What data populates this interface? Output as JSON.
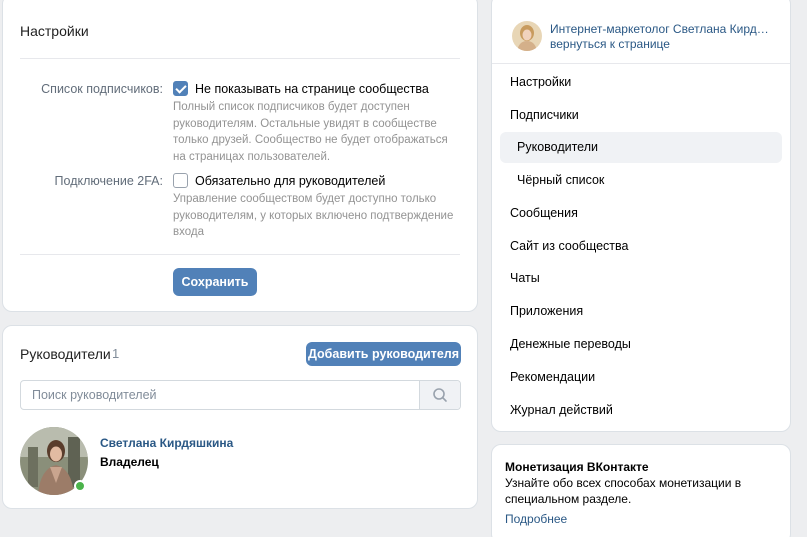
{
  "settings": {
    "title": "Настройки",
    "subscribers_label": "Список подписчиков:",
    "subscribers_option": "Не показывать на странице сообщества",
    "subscribers_checked": true,
    "subscribers_hint": "Полный список подписчиков будет доступен руководителям. Остальные увидят в сообществе только друзей. Сообщество не будет отображаться на страницах пользователей.",
    "twofa_label": "Подключение 2FA:",
    "twofa_option": "Обязательно для руководителей",
    "twofa_checked": false,
    "twofa_hint": "Управление сообществом будет доступно только руководителям, у которых включено подтверждение входа",
    "save_button": "Сохранить"
  },
  "managers": {
    "title": "Руководители",
    "count": "1",
    "add_button": "Добавить руководителя",
    "search_placeholder": "Поиск руководителей",
    "list": [
      {
        "name": "Светлана Кирдяшкина",
        "role": "Владелец",
        "online": true
      }
    ]
  },
  "sidebar": {
    "owner_name": "Интернет-маркетолог Светлана Кирдяшк...",
    "back_link": "вернуться к странице",
    "items": [
      {
        "label": "Настройки",
        "sub": false,
        "active": false
      },
      {
        "label": "Подписчики",
        "sub": false,
        "active": false
      },
      {
        "label": "Руководители",
        "sub": true,
        "active": true
      },
      {
        "label": "Чёрный список",
        "sub": true,
        "active": false
      },
      {
        "label": "Сообщения",
        "sub": false,
        "active": false
      },
      {
        "label": "Сайт из сообщества",
        "sub": false,
        "active": false
      },
      {
        "label": "Чаты",
        "sub": false,
        "active": false
      },
      {
        "label": "Приложения",
        "sub": false,
        "active": false
      },
      {
        "label": "Денежные переводы",
        "sub": false,
        "active": false
      },
      {
        "label": "Рекомендации",
        "sub": false,
        "active": false
      },
      {
        "label": "Журнал действий",
        "sub": false,
        "active": false
      }
    ]
  },
  "monetization": {
    "title": "Монетизация ВКонтакте",
    "text": "Узнайте обо всех способах монетизации в специальном разделе.",
    "link": "Подробнее"
  },
  "colors": {
    "accent": "#5181b8",
    "link": "#2a5885",
    "online": "#4bb34b",
    "background": "#edeef0"
  },
  "icons": {
    "search": "search-icon",
    "checkbox": "checkmark-icon"
  }
}
